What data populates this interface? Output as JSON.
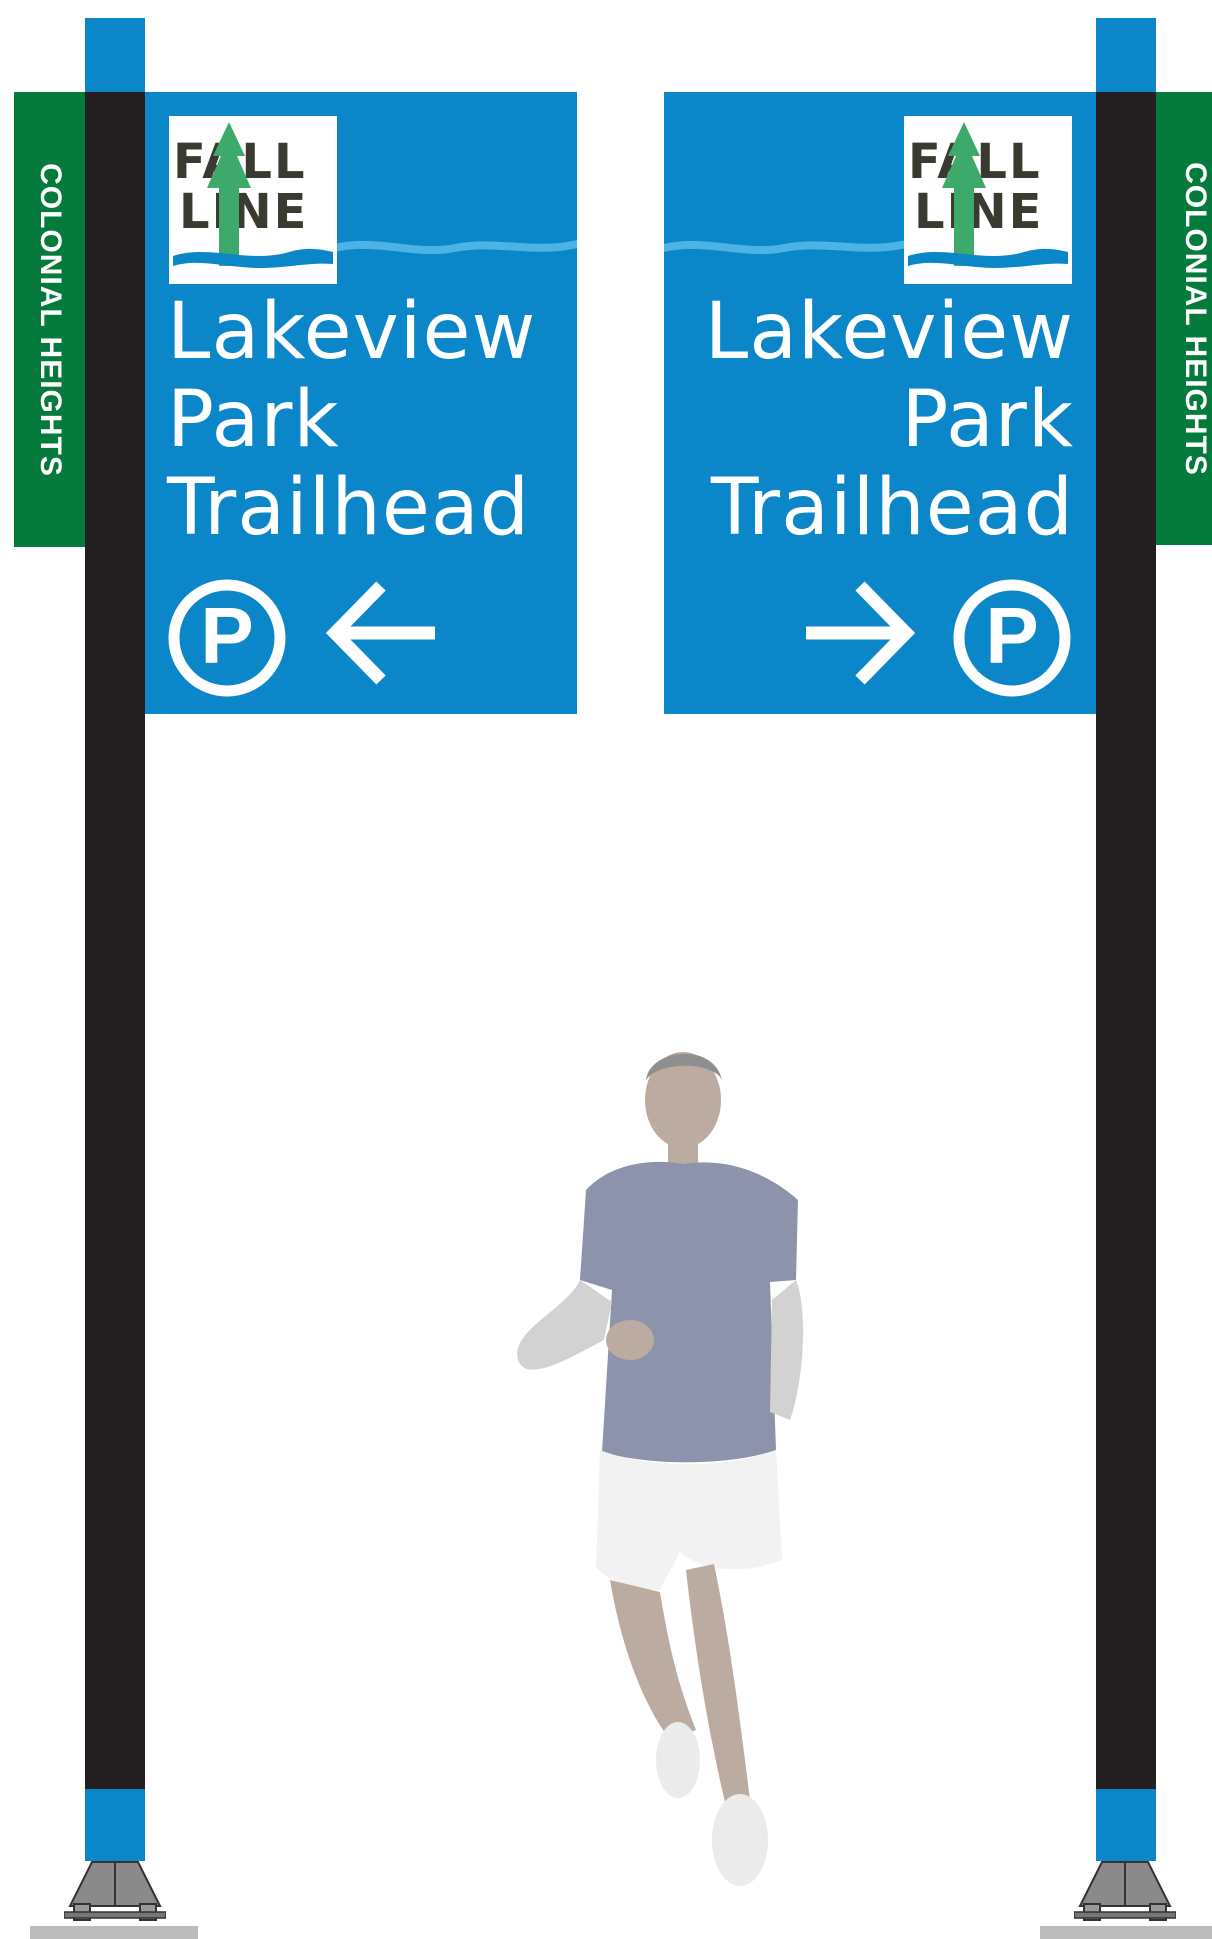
{
  "colors": {
    "panel_blue": "#0b86c9",
    "post_black": "#231f20",
    "side_green": "#047a3d",
    "logo_text": "#3b3a30",
    "logo_tree_green": "#3daa6b",
    "wave_blue": "#0b86c9"
  },
  "left_sign": {
    "side_label": "COLONIAL HEIGHTS",
    "logo": {
      "line1": "FALL",
      "line2": "LINE"
    },
    "destination": [
      "Lakeview",
      "Park",
      "Trailhead"
    ],
    "parking_symbol": "P",
    "arrow_direction": "left"
  },
  "right_sign": {
    "side_label": "COLONIAL HEIGHTS",
    "logo": {
      "line1": "FALL",
      "line2": "LINE"
    },
    "destination": [
      "Lakeview",
      "Park",
      "Trailhead"
    ],
    "parking_symbol": "P",
    "arrow_direction": "right"
  },
  "icons": [
    "parking-icon",
    "arrow-left-icon",
    "arrow-right-icon",
    "tree-icon",
    "wave-icon",
    "runner-figure"
  ]
}
